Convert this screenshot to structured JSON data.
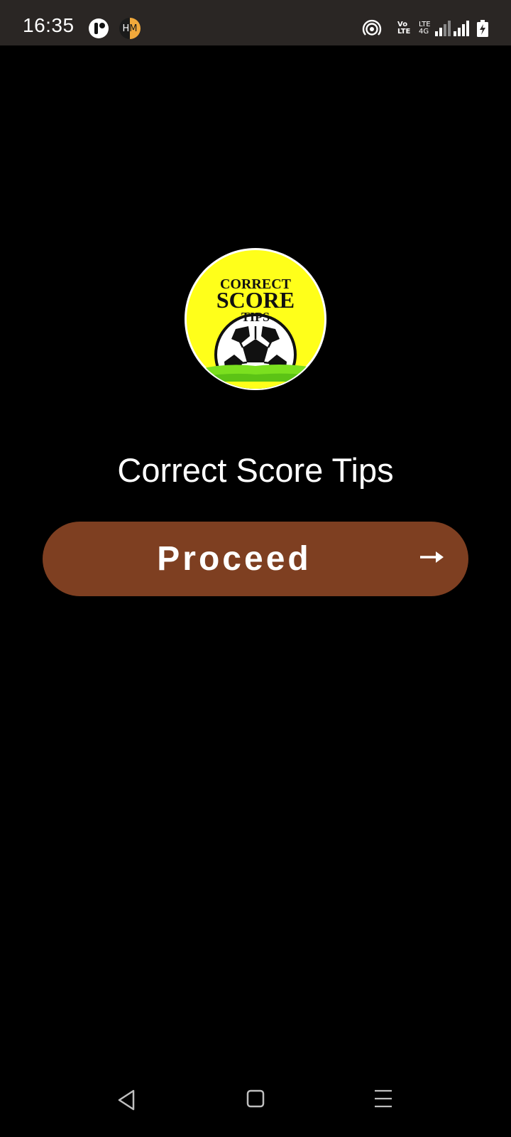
{
  "status_bar": {
    "time": "16:35",
    "notification_icons": [
      "app-notification-icon",
      "hm-app-icon"
    ],
    "hm_badge": {
      "left": "H",
      "right": "M"
    },
    "system_icons": [
      "hotspot-icon",
      "volte-icon",
      "lte-icon",
      "signal-icon",
      "signal-icon",
      "battery-charging-icon"
    ],
    "volte": {
      "line1": "Vo",
      "line2": "LTE"
    },
    "lte": {
      "line1": "LTE",
      "line2": "4G"
    }
  },
  "logo": {
    "line1": "CORRECT",
    "line2": "SCORE",
    "line3": "TIPS",
    "background_color": "#ffff1a",
    "grass_color": "#7be01f"
  },
  "main": {
    "title": "Correct Score Tips",
    "proceed_button": {
      "label": "Proceed",
      "icon": "arrow-right-icon",
      "color": "#7e3f21"
    }
  },
  "nav_bar": {
    "items": [
      "back-icon",
      "home-icon",
      "recents-icon"
    ]
  }
}
